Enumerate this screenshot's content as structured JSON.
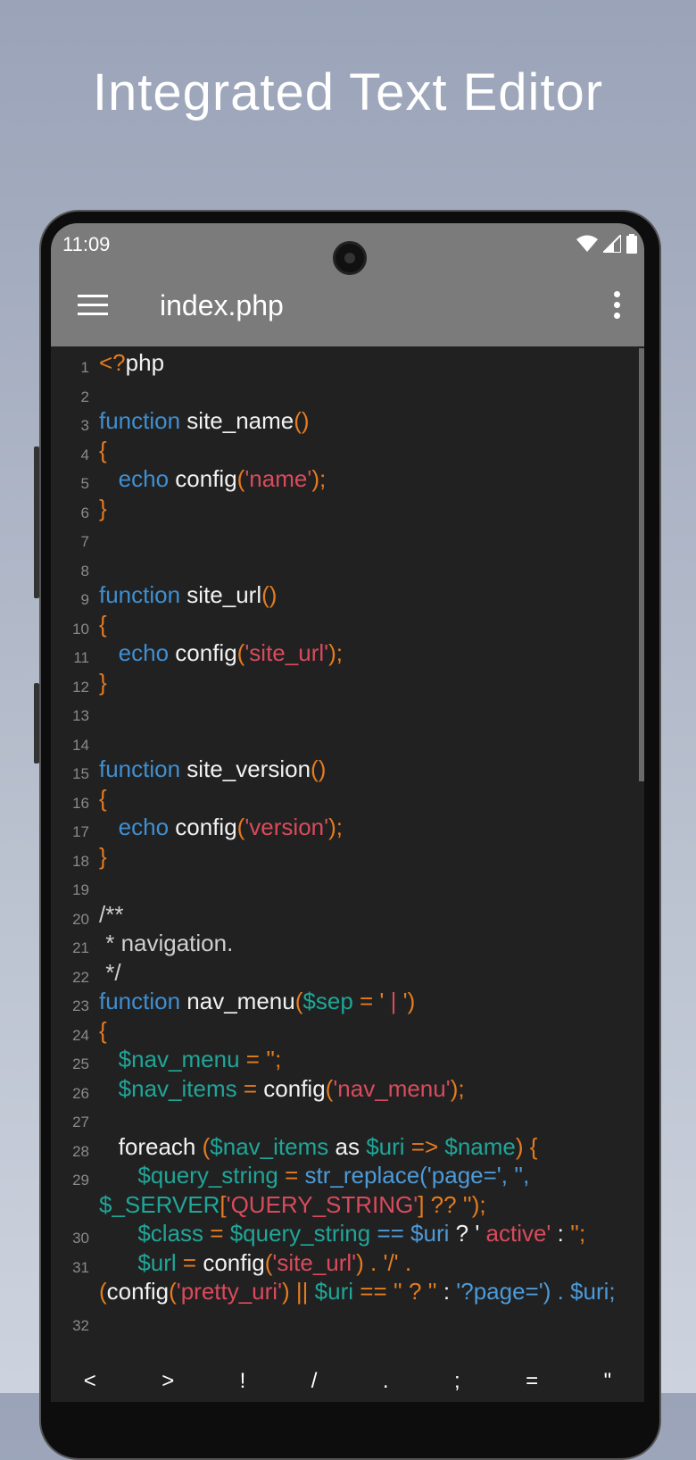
{
  "headline": "Integrated Text Editor",
  "status": {
    "time": "11:09"
  },
  "toolbar": {
    "title": "index.php"
  },
  "code": [
    {
      "n": "1",
      "tokens": [
        [
          "p",
          "<?"
        ],
        [
          "t",
          "php"
        ]
      ]
    },
    {
      "n": "2",
      "tokens": []
    },
    {
      "n": "3",
      "tokens": [
        [
          "k",
          "function"
        ],
        [
          "t",
          " site_name"
        ],
        [
          "p",
          "()"
        ]
      ]
    },
    {
      "n": "4",
      "tokens": [
        [
          "p",
          "{"
        ]
      ]
    },
    {
      "n": "5",
      "tokens": [
        [
          "k",
          "   echo"
        ],
        [
          "t",
          " config"
        ],
        [
          "p",
          "("
        ],
        [
          "s",
          "'name'"
        ],
        [
          "p",
          ");"
        ]
      ]
    },
    {
      "n": "6",
      "tokens": [
        [
          "p",
          "}"
        ]
      ]
    },
    {
      "n": "7",
      "tokens": []
    },
    {
      "n": "8",
      "tokens": []
    },
    {
      "n": "9",
      "tokens": [
        [
          "k",
          "function"
        ],
        [
          "t",
          " site_url"
        ],
        [
          "p",
          "()"
        ]
      ]
    },
    {
      "n": "10",
      "tokens": [
        [
          "p",
          "{"
        ]
      ]
    },
    {
      "n": "11",
      "tokens": [
        [
          "k",
          "   echo"
        ],
        [
          "t",
          " config"
        ],
        [
          "p",
          "("
        ],
        [
          "s",
          "'site_url'"
        ],
        [
          "p",
          ");"
        ]
      ]
    },
    {
      "n": "12",
      "tokens": [
        [
          "p",
          "}"
        ]
      ]
    },
    {
      "n": "13",
      "tokens": []
    },
    {
      "n": "14",
      "tokens": []
    },
    {
      "n": "15",
      "tokens": [
        [
          "k",
          "function"
        ],
        [
          "t",
          " site_version"
        ],
        [
          "p",
          "()"
        ]
      ]
    },
    {
      "n": "16",
      "tokens": [
        [
          "p",
          "{"
        ]
      ]
    },
    {
      "n": "17",
      "tokens": [
        [
          "k",
          "   echo"
        ],
        [
          "t",
          " config"
        ],
        [
          "p",
          "("
        ],
        [
          "s",
          "'version'"
        ],
        [
          "p",
          ");"
        ]
      ]
    },
    {
      "n": "18",
      "tokens": [
        [
          "p",
          "}"
        ]
      ]
    },
    {
      "n": "19",
      "tokens": []
    },
    {
      "n": "20",
      "tokens": [
        [
          "c",
          "/**"
        ]
      ]
    },
    {
      "n": "21",
      "tokens": [
        [
          "c",
          " * navigation."
        ]
      ]
    },
    {
      "n": "22",
      "tokens": [
        [
          "c",
          " */"
        ]
      ]
    },
    {
      "n": "23",
      "tokens": [
        [
          "k",
          "function"
        ],
        [
          "t",
          " nav_menu"
        ],
        [
          "p",
          "("
        ],
        [
          "v",
          "$sep"
        ],
        [
          "p",
          " = '"
        ],
        [
          "s",
          " | "
        ],
        [
          "p",
          "')"
        ]
      ]
    },
    {
      "n": "24",
      "tokens": [
        [
          "p",
          "{"
        ]
      ]
    },
    {
      "n": "25",
      "tokens": [
        [
          "v",
          "   $nav_menu"
        ],
        [
          "p",
          " = '';"
        ]
      ]
    },
    {
      "n": "26",
      "tokens": [
        [
          "v",
          "   $nav_items"
        ],
        [
          "p",
          " = "
        ],
        [
          "t",
          "config"
        ],
        [
          "p",
          "("
        ],
        [
          "s",
          "'nav_menu'"
        ],
        [
          "p",
          ");"
        ]
      ]
    },
    {
      "n": "27",
      "tokens": []
    },
    {
      "n": "28",
      "tokens": [
        [
          "t",
          "   foreach "
        ],
        [
          "p",
          "("
        ],
        [
          "v",
          "$nav_items"
        ],
        [
          "t",
          " as "
        ],
        [
          "v",
          "$uri"
        ],
        [
          "p",
          " => "
        ],
        [
          "v",
          "$name"
        ],
        [
          "p",
          ") {"
        ]
      ]
    },
    {
      "n": "29",
      "tokens": [
        [
          "v",
          "      $query_string"
        ],
        [
          "p",
          " = "
        ],
        [
          "f",
          "str_replace('page=', '',"
        ]
      ]
    },
    {
      "n": "",
      "tokens": [
        [
          "v",
          "$_SERVER"
        ],
        [
          "p",
          "["
        ],
        [
          "s",
          "'QUERY_STRING'"
        ],
        [
          "p",
          "] ?? '');"
        ]
      ]
    },
    {
      "n": "30",
      "tokens": [
        [
          "v",
          "      $class"
        ],
        [
          "p",
          " = "
        ],
        [
          "v",
          "$query_string"
        ],
        [
          "f",
          " == $uri"
        ],
        [
          "t",
          " ? '"
        ],
        [
          "s",
          " active'"
        ],
        [
          "t",
          " : "
        ],
        [
          "p",
          "'';"
        ]
      ]
    },
    {
      "n": "31",
      "tokens": [
        [
          "v",
          "      $url"
        ],
        [
          "p",
          " = "
        ],
        [
          "t",
          "config"
        ],
        [
          "p",
          "("
        ],
        [
          "s",
          "'site_url'"
        ],
        [
          "p",
          ") . '/' ."
        ]
      ]
    },
    {
      "n": "",
      "tokens": [
        [
          "p",
          "("
        ],
        [
          "t",
          "config"
        ],
        [
          "p",
          "("
        ],
        [
          "s",
          "'pretty_uri'"
        ],
        [
          "p",
          ") || "
        ],
        [
          "v",
          "$uri"
        ],
        [
          "p",
          " == '' ? '' "
        ],
        [
          "t",
          ": "
        ],
        [
          "f",
          "'?page=') . $uri;"
        ]
      ]
    },
    {
      "n": "32",
      "tokens": []
    }
  ],
  "keys": [
    "<",
    ">",
    "!",
    "/",
    ".",
    ";",
    "=",
    "\""
  ]
}
